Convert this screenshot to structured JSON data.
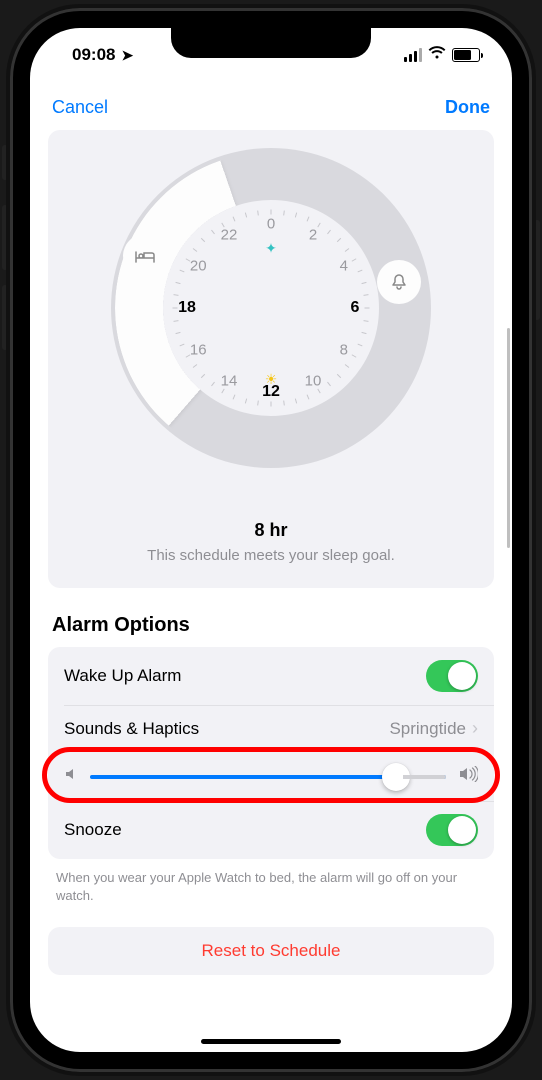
{
  "status": {
    "time": "09:08"
  },
  "nav": {
    "cancel": "Cancel",
    "done": "Done"
  },
  "dial": {
    "numbers": [
      "0",
      "2",
      "4",
      "6",
      "8",
      "10",
      "12",
      "14",
      "16",
      "18",
      "20",
      "22"
    ],
    "bold_indices": [
      3,
      6,
      9
    ],
    "duration": "8 hr",
    "goal": "This schedule meets your sleep goal."
  },
  "alarm": {
    "section": "Alarm Options",
    "wake_label": "Wake Up Alarm",
    "wake_on": true,
    "sounds_label": "Sounds & Haptics",
    "sounds_value": "Springtide",
    "volume_percent": 86,
    "snooze_label": "Snooze",
    "snooze_on": true,
    "footnote": "When you wear your Apple Watch to bed, the alarm will go off on your watch."
  },
  "reset": {
    "label": "Reset to Schedule"
  }
}
